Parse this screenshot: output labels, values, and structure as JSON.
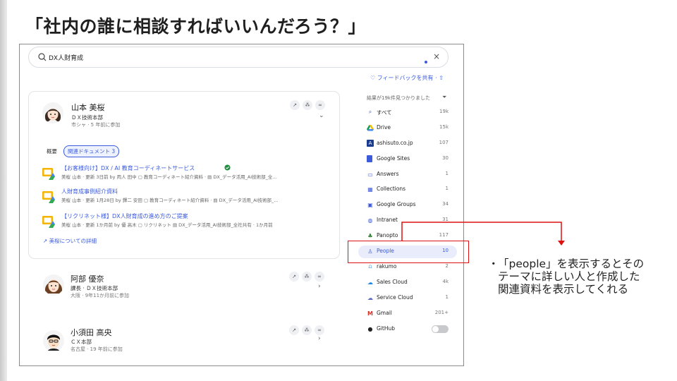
{
  "slide": {
    "title": "「社内の誰に相談すればいいんだろう？」"
  },
  "search": {
    "value": "DX人財育成",
    "clear": "×"
  },
  "feedback": {
    "label": "フィードバックを共有",
    "sep": "·"
  },
  "person1": {
    "name": "山本 美桜",
    "dept": "ＤＸ技術本部",
    "meta": "市シャ · 5 年前に参加",
    "tabs": [
      "概要",
      "関連ドキュメント 3"
    ],
    "docs": [
      {
        "title": "【お客様向け】DX / AI 教育コーディネートサービス",
        "meta": "美桜 山本 · 更新 3日前 by 両人 田中 ▢ 教育コーディネート紹介資料 · ▤ DX_データ活用_AI技術部_全…"
      },
      {
        "title": "人財育成事例紹介資料",
        "meta": "美桜 山本 · 更新 1月28日 by 鐸二 安田 ▢ 教育コーディネート紹介資料 · ▤ DX_データ活用_AI技術部_…"
      },
      {
        "title": "【リクリネット様】DX人財育成の進め方のご提案",
        "meta": "美桜 山本 · 更新 1か月前 by 優 高木 ▢ リクリネット ▤ DX_データ活用_AI技術部_全社共有 · 1か月前"
      }
    ],
    "more": "美桜についての詳細"
  },
  "person2": {
    "name": "阿部 優奈",
    "dept": "課長 · ＤＸ技術本部",
    "meta": "大阪 · 9年11か月前に参加"
  },
  "person3": {
    "name": "小須田 高央",
    "dept": "ＣＸ本部",
    "meta": "名古屋 · 19 年前に参加"
  },
  "sidebar": {
    "header": "結果が19k件見つかりました",
    "items": [
      {
        "label": "すべて",
        "count": "19k",
        "icon": "search-icon",
        "color": "#3b5bdb"
      },
      {
        "label": "Drive",
        "count": "15k",
        "icon": "drive-icon",
        "color": "#0f9d58"
      },
      {
        "label": "ashisuto.co.jp",
        "count": "107",
        "icon": "site-icon",
        "color": "#1a3c8f"
      },
      {
        "label": "Google Sites",
        "count": "30",
        "icon": "google-sites-icon",
        "color": "#3b5bdb"
      },
      {
        "label": "Answers",
        "count": "1",
        "icon": "answers-icon",
        "color": "#3b5bdb"
      },
      {
        "label": "Collections",
        "count": "1",
        "icon": "collections-icon",
        "color": "#3b5bdb"
      },
      {
        "label": "Google Groups",
        "count": "34",
        "icon": "google-groups-icon",
        "color": "#3b5bdb"
      },
      {
        "label": "Intranet",
        "count": "31",
        "icon": "intranet-icon",
        "color": "#3b5bdb"
      },
      {
        "label": "Panopto",
        "count": "117",
        "icon": "panopto-icon",
        "color": "#2e7d32"
      },
      {
        "label": "People",
        "count": "10",
        "icon": "people-icon",
        "color": "#3b5bdb"
      },
      {
        "label": "rakumo",
        "count": "2",
        "icon": "rakumo-icon",
        "color": "#3b8fdb"
      },
      {
        "label": "Sales Cloud",
        "count": "4k",
        "icon": "sales-cloud-icon",
        "color": "#1e88e5"
      },
      {
        "label": "Service Cloud",
        "count": "1",
        "icon": "service-cloud-icon",
        "color": "#5c6bc0"
      },
      {
        "label": "Gmail",
        "count": "201+",
        "icon": "gmail-icon",
        "color": "#d93025"
      },
      {
        "label": "GitHub",
        "count": "",
        "icon": "github-icon",
        "color": "#222222"
      }
    ]
  },
  "callout": {
    "bullet": "・",
    "text": "「people」を表示するとそのテーマに詳しい人と作成した関連資料を表示してくれる"
  },
  "colors": {
    "accent": "#3b5bdb",
    "highlight": "#e9edfb",
    "annotation": "#dd1111"
  }
}
